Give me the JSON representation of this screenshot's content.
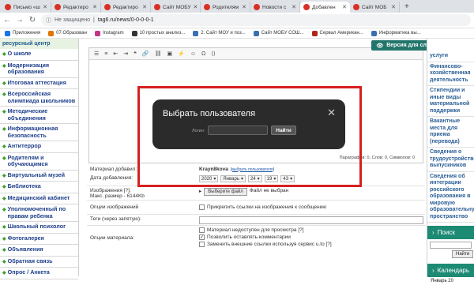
{
  "tabs": [
    {
      "label": "Письмо «ш",
      "color": "#d93025"
    },
    {
      "label": "Редактиро",
      "color": "#d93025"
    },
    {
      "label": "Редактиро",
      "color": "#d93025"
    },
    {
      "label": "Сайт МОБУ",
      "color": "#d93025"
    },
    {
      "label": "Родителям",
      "color": "#d93025"
    },
    {
      "label": "Новости с",
      "color": "#d93025"
    },
    {
      "label": "Добавлен",
      "color": "#d93025"
    },
    {
      "label": "Сайт МОБ",
      "color": "#d93025"
    }
  ],
  "address": {
    "security": "Не защищено",
    "url": "tag6.ru/news/0-0-0-0-1"
  },
  "bookmarks": [
    "Приложения",
    "07.Образован",
    "Instagram",
    "10 простых анализ...",
    "2. Сайт МОУ и поз...",
    "Сайт МОБУ СОШ...",
    "Сервал Американ...",
    "Информатика вы..."
  ],
  "left_menu": {
    "header": "ресурсный центр",
    "items": [
      {
        "label": "О школе",
        "green": false
      },
      {
        "label": "Модернизация образования",
        "green": false
      },
      {
        "label": "Итоговая аттестация",
        "green": false
      },
      {
        "label": "Всероссийская олимпиада школьников",
        "green": false
      },
      {
        "label": "Методические объединения",
        "green": false
      },
      {
        "label": "Информационная безопасность",
        "green": false
      },
      {
        "label": "Антитеррор",
        "green": false
      },
      {
        "label": "Родителям и обучающимся",
        "green": false
      },
      {
        "label": "Виртуальный музей",
        "green": false
      },
      {
        "label": "Библиотека",
        "green": false
      },
      {
        "label": "Медицинский кабинет",
        "green": false
      },
      {
        "label": "Уполномоченный по правам ребенка",
        "green": false
      },
      {
        "label": "Школьный психолог",
        "green": false
      },
      {
        "label": "Фотогалерея",
        "green": false
      },
      {
        "label": "Объявления",
        "green": false
      },
      {
        "label": "Обратная связь",
        "green": false
      },
      {
        "label": "Опрос / Анкета",
        "green": false
      }
    ]
  },
  "editor": {
    "toolbar_icons": [
      "bullet-list-icon",
      "numbered-list-icon",
      "outdent-icon",
      "indent-icon",
      "quote-icon",
      "link-icon",
      "unlink-icon",
      "image-icon",
      "flash-icon",
      "smiley-icon",
      "special-char-icon",
      "html-icon"
    ],
    "status": "Параграфов: 0, Слов: 0, Символов: 0"
  },
  "form": {
    "author_label": "Материал добавил:",
    "author_value": "Krayn8kova",
    "author_link": "[выбрать пользователя]",
    "date_label": "Дата добавления:",
    "date_year": "2020",
    "date_month": "Январь",
    "date_day": "24",
    "date_hour": "19",
    "date_min": "43",
    "images_label": "Изображения [?]:",
    "images_size": "Макс. размер - 6144Kb",
    "choose_file": "Выберите файл",
    "no_file": "Файл не выбран",
    "img_options_label": "Опции изображений",
    "img_option": "Прикрепить ссылки на изображения к сообщению",
    "tags_label": "Теги (через запятую):",
    "material_options_label": "Опции материала:",
    "opt1": "Материал недоступен для просмотра [?]",
    "opt2": "Позволить оставлять комментарии",
    "opt3": "Заменить внешние ссылки используя сервис u.to [?]"
  },
  "right": {
    "version_btn": "Версия для слабовидящих",
    "links": [
      "услуги",
      "Финансово-хозяйственная деятельность",
      "Стипендии и иные виды материальной поддержки",
      "Вакантные места для приема (перевода)",
      "Сведения о трудоустройстве выпускников",
      "Сведения об интеграции российского образования в мировую образовательную пространство"
    ],
    "search_title": "Поиск",
    "search_btn": "Найти",
    "calendar_title": "Календарь",
    "calendar_month": "Январь 20"
  },
  "dialog": {
    "title": "Выбрать пользователя",
    "login_label": "Логин:",
    "find_btn": "Найти"
  }
}
